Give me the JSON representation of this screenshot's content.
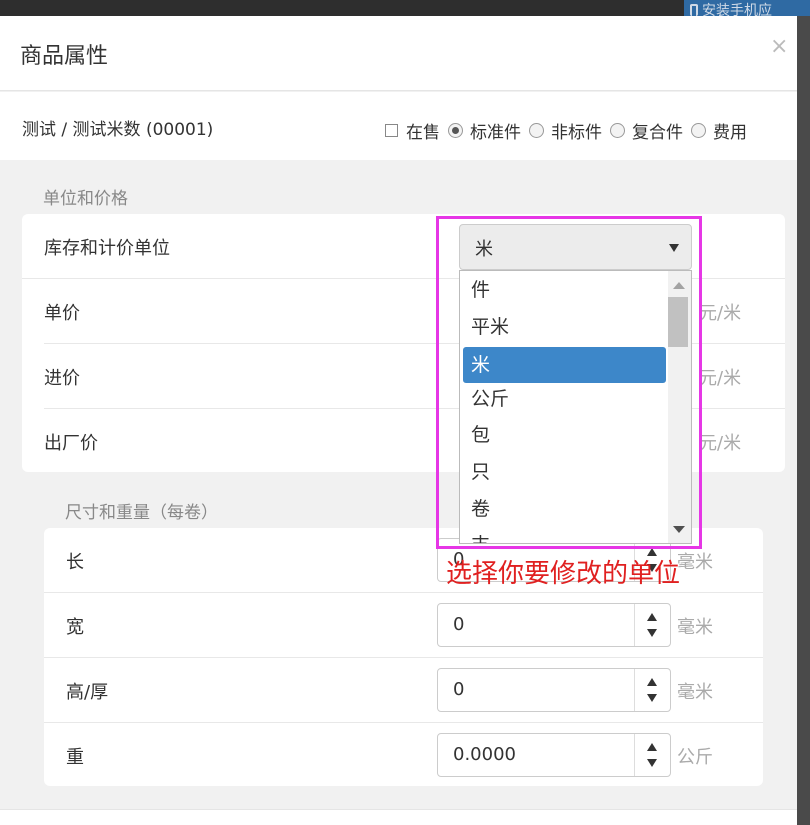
{
  "background": {
    "install_button_label": "安装手机应"
  },
  "modal": {
    "title": "商品属性",
    "close_label": "×"
  },
  "info": {
    "breadcrumb": "测试 / 测试米数 (00001)",
    "options": [
      {
        "type": "checkbox",
        "label": "在售",
        "checked": false
      },
      {
        "type": "radio",
        "label": "标准件",
        "checked": true
      },
      {
        "type": "radio",
        "label": "非标件",
        "checked": false
      },
      {
        "type": "radio",
        "label": "复合件",
        "checked": false
      },
      {
        "type": "radio",
        "label": "费用",
        "checked": false
      }
    ]
  },
  "unit_price": {
    "section_title": "单位和价格",
    "unit_row_label": "库存和计价单位",
    "selected_unit": "米",
    "rows": [
      {
        "label": "单价",
        "unit": "元/米"
      },
      {
        "label": "进价",
        "unit": "元/米"
      },
      {
        "label": "出厂价",
        "unit": "元/米"
      }
    ]
  },
  "dropdown": {
    "options": [
      "件",
      "平米",
      "米",
      "公斤",
      "包",
      "只",
      "卷",
      "支"
    ],
    "selected_index": 2
  },
  "dimensions": {
    "section_title": "尺寸和重量（每卷）",
    "rows": [
      {
        "label": "长",
        "value": "0",
        "unit": "毫米"
      },
      {
        "label": "宽",
        "value": "0",
        "unit": "毫米"
      },
      {
        "label": "高/厚",
        "value": "0",
        "unit": "毫米"
      },
      {
        "label": "重",
        "value": "0.0000",
        "unit": "公斤"
      }
    ]
  },
  "annotation": {
    "text": "选择你要修改的单位",
    "color": "#e02020",
    "box_color": "#e636e6"
  },
  "colors": {
    "accent": "#3d87c9"
  }
}
